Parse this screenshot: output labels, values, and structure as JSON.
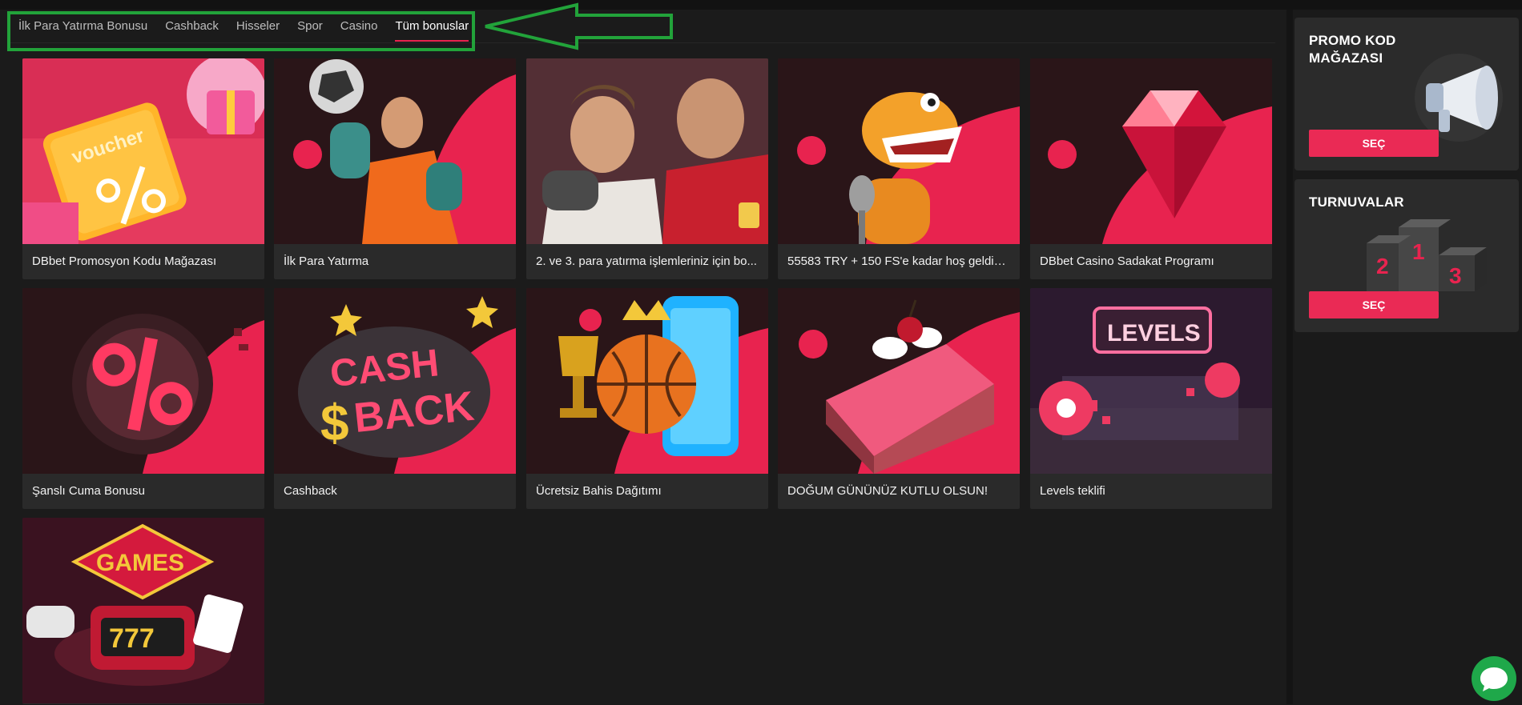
{
  "tabs": [
    {
      "label": "İlk Para Yatırma Bonusu"
    },
    {
      "label": "Cashback"
    },
    {
      "label": "Hisseler"
    },
    {
      "label": "Spor"
    },
    {
      "label": "Casino"
    },
    {
      "label": "Tüm bonuslar",
      "active": true
    }
  ],
  "cards": [
    {
      "title": "DBbet Promosyon Kodu Mağazası",
      "icon": "voucher-gift-image"
    },
    {
      "title": "İlk Para Yatırma",
      "icon": "goalkeeper-image"
    },
    {
      "title": "2. ve 3. para yatırma işlemleriniz için bo...",
      "icon": "football-players-image"
    },
    {
      "title": "55583 TRY + 150 FS'e kadar hoş geldin ...",
      "icon": "dinosaur-microphone-image"
    },
    {
      "title": "DBbet Casino Sadakat Programı",
      "icon": "ruby-gem-image"
    },
    {
      "title": "Şanslı Cuma Bonusu",
      "icon": "percent-badge-image"
    },
    {
      "title": "Cashback",
      "icon": "cashback-cloud-image"
    },
    {
      "title": "Ücretsiz Bahis Dağıtımı",
      "icon": "basketball-trophy-image"
    },
    {
      "title": "DOĞUM GÜNÜNÜZ KUTLU OLSUN!",
      "icon": "birthday-cake-image"
    },
    {
      "title": "Levels teklifi",
      "icon": "levels-stadium-image"
    },
    {
      "title": "",
      "icon": "games-slot-machine-image"
    }
  ],
  "images": {
    "voucher_text": "voucher",
    "cashback_line1": "CASH",
    "cashback_line2": "BACK",
    "levels_text": "LEVELS",
    "games_text": "GAMES",
    "slot_text": "777"
  },
  "sidebar": {
    "promo": {
      "title": "PROMO KOD MAĞAZASI",
      "button": "SEÇ",
      "icon": "megaphone-icon"
    },
    "tournaments": {
      "title": "TURNUVALAR",
      "button": "SEÇ",
      "icon": "podium-icon",
      "podium": [
        "2",
        "1",
        "3"
      ]
    }
  },
  "chat": {
    "icon": "chat-bubble-icon"
  },
  "colors": {
    "accent": "#ea2a55",
    "background": "#1b1b1b",
    "card": "#2a2a2a",
    "annotation": "#22a33a",
    "chat": "#1fa84a"
  }
}
